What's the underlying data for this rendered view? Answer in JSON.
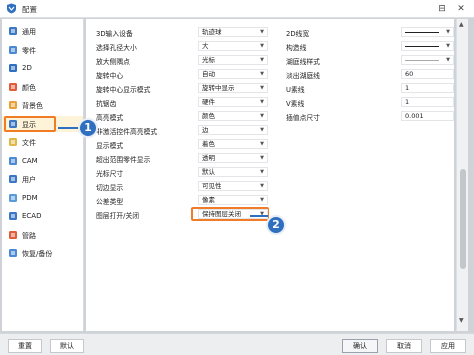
{
  "window": {
    "title": "配置",
    "close_glyph": "✕",
    "pin_glyph": "⊟"
  },
  "sidebar": {
    "items": [
      {
        "label": "通用",
        "icon": "general-icon",
        "color": "#3b78c4"
      },
      {
        "label": "零件",
        "icon": "part-icon",
        "color": "#4a8ad4"
      },
      {
        "label": "2D",
        "icon": "2d-icon",
        "color": "#2f6fbf"
      },
      {
        "label": "颜色",
        "icon": "color-icon",
        "color": "#e05c3a"
      },
      {
        "label": "背景色",
        "icon": "background-color-icon",
        "color": "#e8a03a"
      },
      {
        "label": "显示",
        "icon": "display-icon",
        "color": "#3b78c4"
      },
      {
        "label": "文件",
        "icon": "file-icon",
        "color": "#e0b84a"
      },
      {
        "label": "CAM",
        "icon": "cam-icon",
        "color": "#4a8ad4"
      },
      {
        "label": "用户",
        "icon": "user-icon",
        "color": "#3b78c4"
      },
      {
        "label": "PDM",
        "icon": "pdm-icon",
        "color": "#5a9ad8"
      },
      {
        "label": "ECAD",
        "icon": "ecad-icon",
        "color": "#3b78c4"
      },
      {
        "label": "管路",
        "icon": "pipe-icon",
        "color": "#e05c3a"
      },
      {
        "label": "恢复/备份",
        "icon": "restore-icon",
        "color": "#4a8ad4"
      }
    ],
    "active_index": 5
  },
  "settings": {
    "rows": [
      {
        "label": "3D输入设备",
        "value": "轨迹球",
        "rlabel": "2D线宽",
        "rvalue": "line",
        "rkind": "line"
      },
      {
        "label": "选择孔径大小",
        "value": "大",
        "rlabel": "构造线",
        "rvalue": "line",
        "rkind": "line"
      },
      {
        "label": "放大侧隅点",
        "value": "光标",
        "rlabel": "湖庭线样式",
        "rvalue": "thin",
        "rkind": "line"
      },
      {
        "label": "旋转中心",
        "value": "自动",
        "rlabel": "淡出湖庭线",
        "rvalue": "60",
        "rkind": "text"
      },
      {
        "label": "旋转中心显示模式",
        "value": "旋转中显示",
        "rlabel": "U素线",
        "rvalue": "1",
        "rkind": "text"
      },
      {
        "label": "抗锯齿",
        "value": "硬件",
        "rlabel": "V素线",
        "rvalue": "1",
        "rkind": "text"
      },
      {
        "label": "高亮模式",
        "value": "颜色",
        "rlabel": "插值点尺寸",
        "rvalue": "0.001",
        "rkind": "text"
      },
      {
        "label": "非激活控件高亮模式",
        "value": "边",
        "rlabel": "",
        "rvalue": "",
        "rkind": "none"
      },
      {
        "label": "显示模式",
        "value": "着色",
        "rlabel": "",
        "rvalue": "",
        "rkind": "none"
      },
      {
        "label": "超出范围零件显示",
        "value": "透明",
        "rlabel": "",
        "rvalue": "",
        "rkind": "none"
      },
      {
        "label": "光标尺寸",
        "value": "默认",
        "rlabel": "",
        "rvalue": "",
        "rkind": "none"
      },
      {
        "label": "切边显示",
        "value": "可见性",
        "rlabel": "",
        "rvalue": "",
        "rkind": "none"
      },
      {
        "label": "公差类型",
        "value": "像素",
        "rlabel": "",
        "rvalue": "",
        "rkind": "none"
      },
      {
        "label": "图层打开/关闭",
        "value": "保持图层关闭",
        "rlabel": "",
        "rvalue": "",
        "rkind": "none"
      }
    ]
  },
  "markers": {
    "one": "1",
    "two": "2"
  },
  "footer": {
    "reset": "重置",
    "default": "默认",
    "ok": "确认",
    "cancel": "取消",
    "apply": "应用"
  },
  "colors": {
    "highlight": "#f07c28",
    "marker": "#2f6fbf"
  }
}
